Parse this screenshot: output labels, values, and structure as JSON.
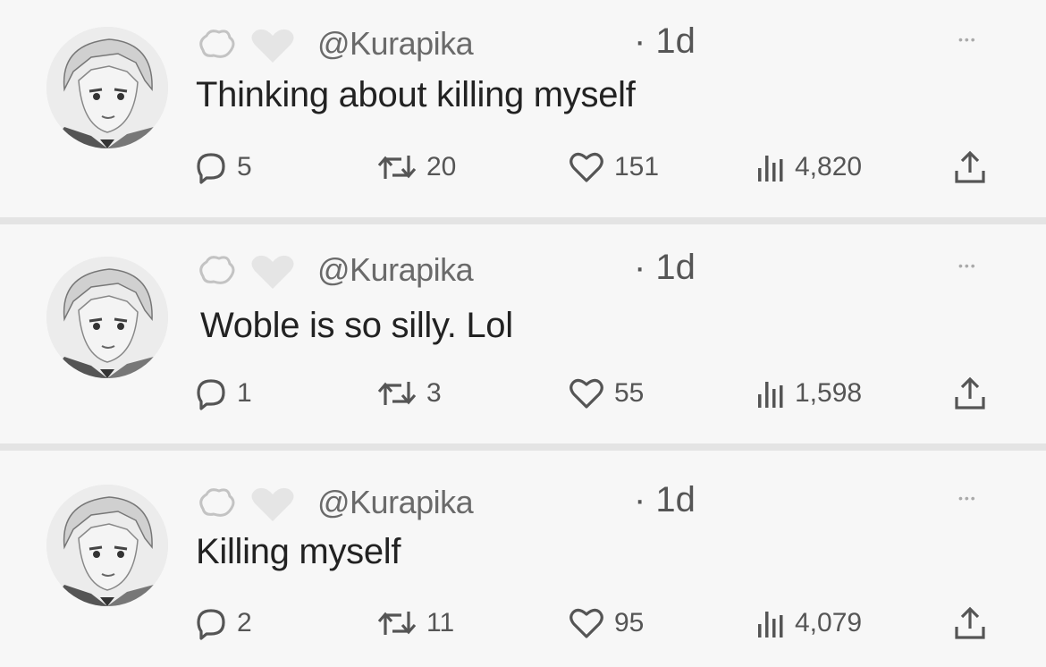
{
  "tweets": [
    {
      "handle": "@Kurapika",
      "time": "· 1d",
      "text": "Thinking about killing myself",
      "replies": "5",
      "retweets": "20",
      "likes": "151",
      "views": "4,820"
    },
    {
      "handle": "@Kurapika",
      "time": "· 1d",
      "text": "Woble is  so silly. Lol",
      "replies": "1",
      "retweets": "3",
      "likes": "55",
      "views": "1,598"
    },
    {
      "handle": "@Kurapika",
      "time": "· 1d",
      "text": "Killing myself",
      "replies": "2",
      "retweets": "11",
      "likes": "95",
      "views": "4,079"
    }
  ],
  "icons": {
    "reply": "reply-icon",
    "retweet": "retweet-icon",
    "like": "heart-icon",
    "views": "views-icon",
    "share": "share-icon",
    "more": "more-icon"
  },
  "colors": {
    "background": "#f7f7f7",
    "divider": "#e4e4e4",
    "handle": "#6a6a6a",
    "text": "#222222",
    "icon": "#555555"
  }
}
